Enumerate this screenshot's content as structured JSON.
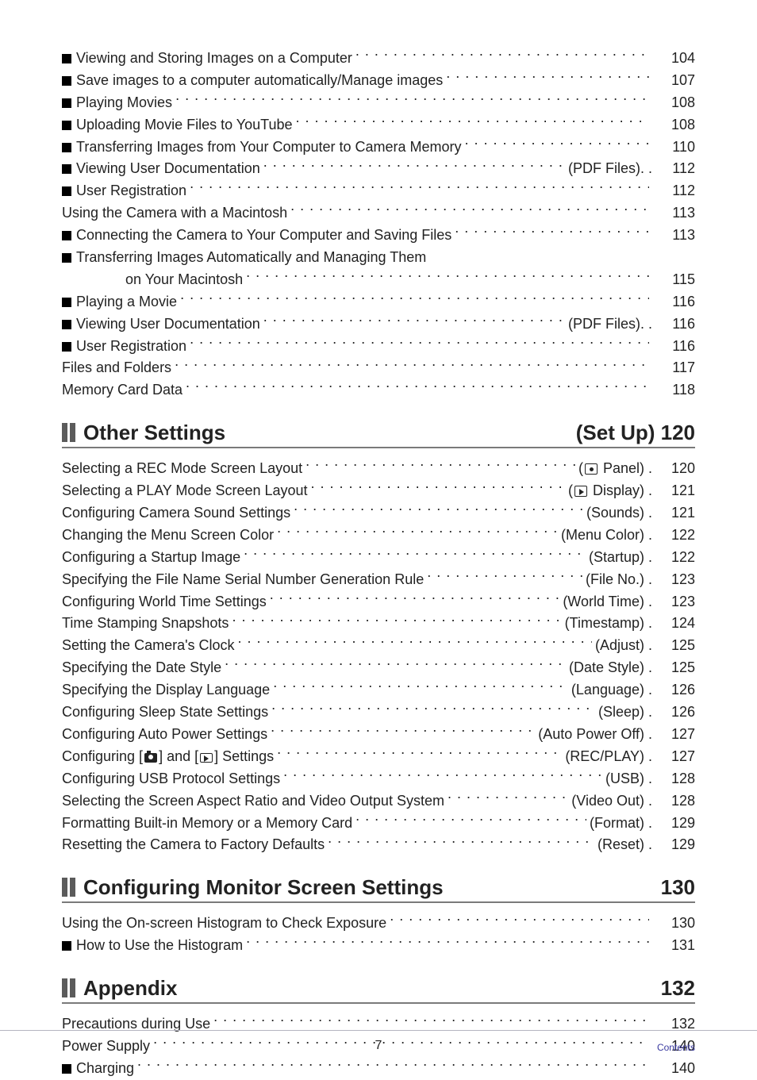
{
  "topItems": [
    {
      "bullet": true,
      "label": "Viewing and Storing Images on a Computer",
      "suffix": "",
      "page": "104"
    },
    {
      "bullet": true,
      "label": "Save images to a computer automatically/Manage images",
      "suffix": "",
      "page": "107"
    },
    {
      "bullet": true,
      "label": "Playing Movies",
      "suffix": "",
      "page": "108"
    },
    {
      "bullet": true,
      "label": "Uploading Movie Files to YouTube",
      "suffix": "",
      "page": "108"
    },
    {
      "bullet": true,
      "label": "Transferring Images from Your Computer to Camera Memory",
      "suffix": "",
      "page": "110"
    },
    {
      "bullet": true,
      "label": "Viewing User Documentation",
      "suffix": "(PDF Files). .",
      "page": "112",
      "halfDots": true
    },
    {
      "bullet": true,
      "label": "User Registration",
      "suffix": "",
      "page": "112"
    },
    {
      "bullet": false,
      "label": "Using the Camera with a Macintosh",
      "suffix": "",
      "page": "113",
      "topLevel": true
    },
    {
      "bullet": true,
      "label": "Connecting the Camera to Your Computer and Saving Files",
      "suffix": "",
      "page": "113"
    },
    {
      "bullet": true,
      "label": "Transferring Images Automatically and Managing Them",
      "suffix": "",
      "page": "",
      "noPage": true
    },
    {
      "bullet": false,
      "label": "on Your Macintosh",
      "continuation": true,
      "suffix": "",
      "page": "115"
    },
    {
      "bullet": true,
      "label": "Playing a Movie",
      "suffix": "",
      "page": "116"
    },
    {
      "bullet": true,
      "label": "Viewing User Documentation",
      "suffix": "(PDF Files). .",
      "page": "116",
      "halfDots": true
    },
    {
      "bullet": true,
      "label": "User Registration",
      "suffix": "",
      "page": "116"
    },
    {
      "bullet": false,
      "label": "Files and Folders",
      "suffix": "",
      "page": "117",
      "topLevel": true
    },
    {
      "bullet": false,
      "label": "Memory Card Data",
      "suffix": "",
      "page": "118",
      "topLevel": true
    }
  ],
  "section1": {
    "title": "Other Settings",
    "meta": "(Set Up)  120"
  },
  "s1Items": [
    {
      "label": "Selecting a REC Mode Screen Layout",
      "suffix": " Panel) .",
      "icon": "panel",
      "prefix": "(",
      "page": "120"
    },
    {
      "label": "Selecting a PLAY Mode Screen Layout",
      "suffix": " Display) .",
      "icon": "display",
      "prefix": "(",
      "page": "121"
    },
    {
      "label": "Configuring Camera Sound Settings",
      "suffix": "(Sounds) .",
      "page": "121"
    },
    {
      "label": "Changing the Menu Screen Color",
      "suffix": "(Menu Color) .",
      "page": "122"
    },
    {
      "label": "Configuring a Startup Image",
      "suffix": "(Startup) .",
      "page": "122"
    },
    {
      "label": "Specifying the File Name Serial Number Generation Rule",
      "suffix": "(File No.) .",
      "shortDots": true,
      "page": "123"
    },
    {
      "label": "Configuring World Time Settings",
      "suffix": "(World Time) .",
      "page": "123"
    },
    {
      "label": "Time Stamping Snapshots",
      "suffix": "(Timestamp) .",
      "page": "124"
    },
    {
      "label": "Setting the Camera's Clock",
      "suffix": "(Adjust) .",
      "page": "125"
    },
    {
      "label": "Specifying the Date Style",
      "suffix": "(Date Style) .",
      "page": "125"
    },
    {
      "label": "Specifying the Display Language",
      "suffix": "(Language) .",
      "page": "126"
    },
    {
      "label": "Configuring Sleep State Settings",
      "suffix": "(Sleep) .",
      "page": "126"
    },
    {
      "label": "Configuring Auto Power Settings",
      "suffix": "(Auto Power Off) .",
      "page": "127"
    },
    {
      "label": "Configuring [CAM] and [PLAY] Settings",
      "icons2": true,
      "suffix": "(REC/PLAY) .",
      "page": "127"
    },
    {
      "label": "Configuring USB Protocol Settings",
      "suffix": "(USB) .",
      "page": "128"
    },
    {
      "label": "Selecting the Screen Aspect Ratio and Video Output System",
      "suffix": "(Video Out)  .",
      "page": "128"
    },
    {
      "label": "Formatting Built-in Memory or a Memory Card",
      "suffix": "(Format) .",
      "page": "129"
    },
    {
      "label": "Resetting the Camera to Factory Defaults",
      "suffix": "(Reset) .",
      "page": "129"
    }
  ],
  "section2": {
    "title": "Configuring Monitor Screen Settings",
    "meta": "130"
  },
  "s2Items": [
    {
      "bullet": false,
      "label": "Using the On-screen Histogram to Check Exposure",
      "suffix": "",
      "page": "130"
    },
    {
      "bullet": true,
      "label": "How to Use the Histogram",
      "suffix": "",
      "page": "131"
    }
  ],
  "section3": {
    "title": "Appendix",
    "meta": "132"
  },
  "s3Items": [
    {
      "bullet": false,
      "label": "Precautions during Use",
      "suffix": "",
      "page": "132"
    },
    {
      "bullet": false,
      "label": "Power Supply",
      "suffix": "",
      "page": "140"
    },
    {
      "bullet": true,
      "label": "Charging",
      "suffix": "",
      "page": "140"
    }
  ],
  "footer": {
    "page": "7",
    "label": "Contents"
  }
}
